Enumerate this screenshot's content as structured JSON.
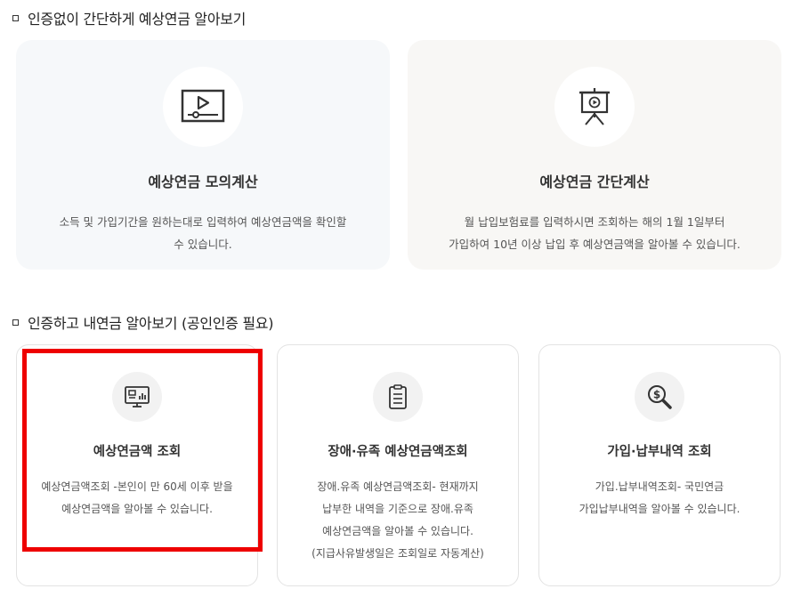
{
  "sections": {
    "no_auth": {
      "title": "인증없이 간단하게 예상연금 알아보기"
    },
    "auth": {
      "title": "인증하고 내연금 알아보기 (공인인증 필요)"
    }
  },
  "no_auth_cards": [
    {
      "icon": "video-player-icon",
      "title": "예상연금 모의계산",
      "desc_lines": [
        "소득 및 가입기간을 원하는대로 입력하여 예상연금액을 확인할",
        "수 있습니다."
      ]
    },
    {
      "icon": "presentation-board-icon",
      "title": "예상연금 간단계산",
      "desc_lines": [
        "월 납입보험료를 입력하시면 조회하는 해의 1월 1일부터",
        "가입하여 10년 이상 납입 후 예상연금액을 알아볼 수 있습니다."
      ]
    }
  ],
  "auth_cards": [
    {
      "icon": "monitor-chart-icon",
      "title": "예상연금액 조회",
      "desc_lines": [
        "예상연금액조회 -본인이 만 60세 이후 받을",
        "예상연금액을 알아볼 수 있습니다."
      ]
    },
    {
      "icon": "clipboard-icon",
      "title": "장애·유족 예상연금액조회",
      "desc_lines": [
        "장애.유족 예상연금액조회- 현재까지",
        "납부한 내역을 기준으로 장애.유족",
        "예상연금액을 알아볼 수 있습니다.",
        "(지급사유발생일은 조회일로 자동계산)"
      ]
    },
    {
      "icon": "dollar-search-icon",
      "title": "가입·납부내역 조회",
      "desc_lines": [
        "가입.납부내역조회- 국민연금",
        "가입납부내역을 알아볼 수 있습니다."
      ]
    }
  ],
  "colors": {
    "highlight": "#ee0000",
    "card_bg_1": "#f6f8fa",
    "card_bg_2": "#f8f7f5"
  }
}
